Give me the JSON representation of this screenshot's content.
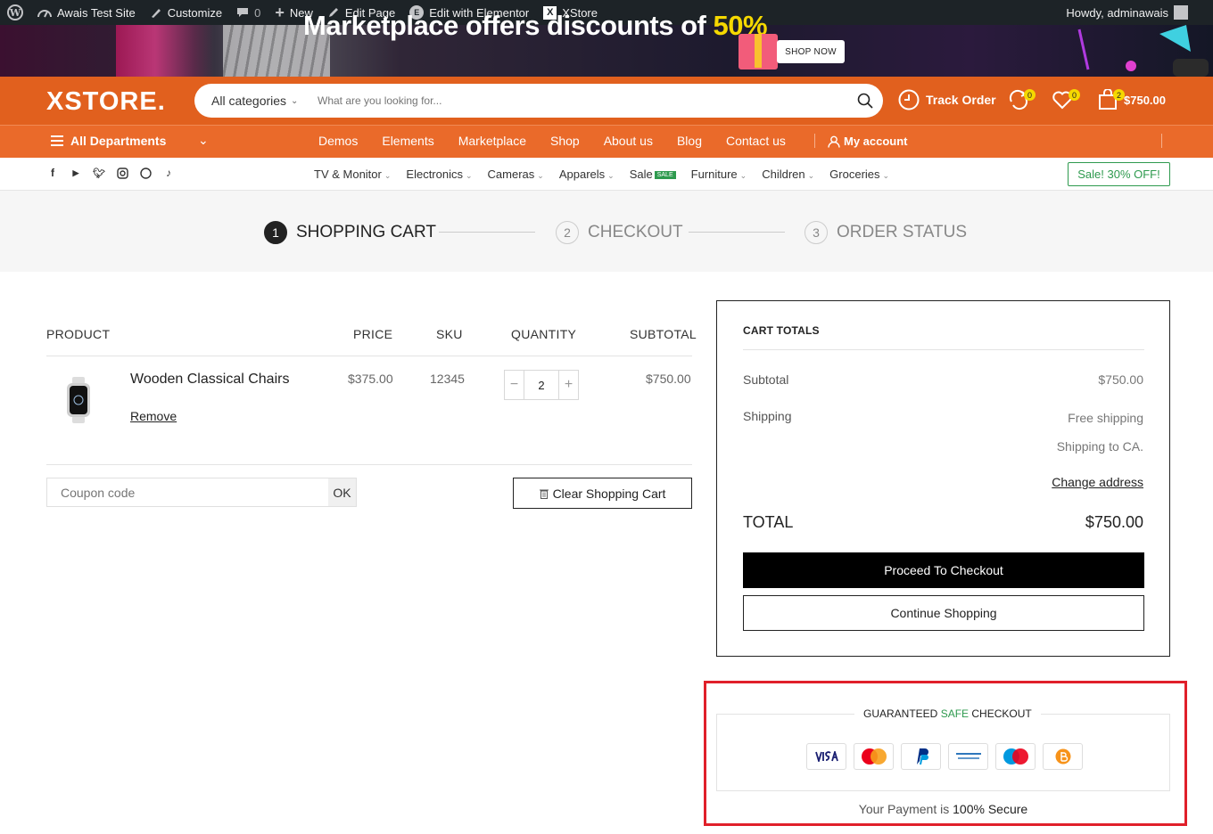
{
  "admin_bar": {
    "site_name": "Awais Test Site",
    "customize": "Customize",
    "comments": "0",
    "new": "New",
    "edit_page": "Edit Page",
    "edit_elementor": "Edit with Elementor",
    "theme": "XStore",
    "howdy": "Howdy, adminawais"
  },
  "banner": {
    "text": "Marketplace offers discounts of",
    "highlight": "50%",
    "cta": "SHOP NOW"
  },
  "header": {
    "logo": "XSTORE.",
    "search_category": "All categories",
    "search_placeholder": "What are you looking for...",
    "track_order": "Track Order",
    "compare_count": "0",
    "wishlist_count": "0",
    "cart_count": "2",
    "cart_total": "$750.00"
  },
  "nav": {
    "departments": "All Departments",
    "links": [
      "Demos",
      "Elements",
      "Marketplace",
      "Shop",
      "About us",
      "Blog",
      "Contact us"
    ],
    "account": "My account"
  },
  "subnav": {
    "categories": [
      "TV & Monitor",
      "Electronics",
      "Cameras",
      "Apparels",
      "Sale",
      "Furniture",
      "Children",
      "Groceries"
    ],
    "sale_badge": "SALE",
    "promo": "Sale! 30% OFF!"
  },
  "steps": [
    {
      "num": "1",
      "label": "SHOPPING CART"
    },
    {
      "num": "2",
      "label": "CHECKOUT"
    },
    {
      "num": "3",
      "label": "ORDER STATUS"
    }
  ],
  "cart": {
    "headers": {
      "product": "PRODUCT",
      "price": "PRICE",
      "sku": "SKU",
      "quantity": "QUANTITY",
      "subtotal": "SUBTOTAL"
    },
    "item": {
      "name": "Wooden Classical Chairs",
      "remove": "Remove",
      "price": "$375.00",
      "sku": "12345",
      "quantity": "2",
      "subtotal": "$750.00"
    },
    "coupon_placeholder": "Coupon code",
    "coupon_button": "OK",
    "clear_button": "Clear Shopping Cart"
  },
  "totals": {
    "title": "CART TOTALS",
    "subtotal_label": "Subtotal",
    "subtotal_value": "$750.00",
    "shipping_label": "Shipping",
    "shipping_value": "Free shipping",
    "shipping_to": "Shipping to CA.",
    "change_address": "Change address",
    "total_label": "TOTAL",
    "total_value": "$750.00",
    "checkout_button": "Proceed To Checkout",
    "continue_button": "Continue Shopping"
  },
  "secure": {
    "title_before": "GUARANTEED",
    "title_green": "SAFE",
    "title_after": "CHECKOUT",
    "note_before": "Your Payment is",
    "note_bold": "100% Secure"
  },
  "colors": {
    "brand_orange": "#e1601e",
    "nav_orange": "#ea6a2a",
    "badge_yellow": "#f5d800",
    "sale_green": "#2e9a4e",
    "highlight_red": "#e0202a"
  }
}
